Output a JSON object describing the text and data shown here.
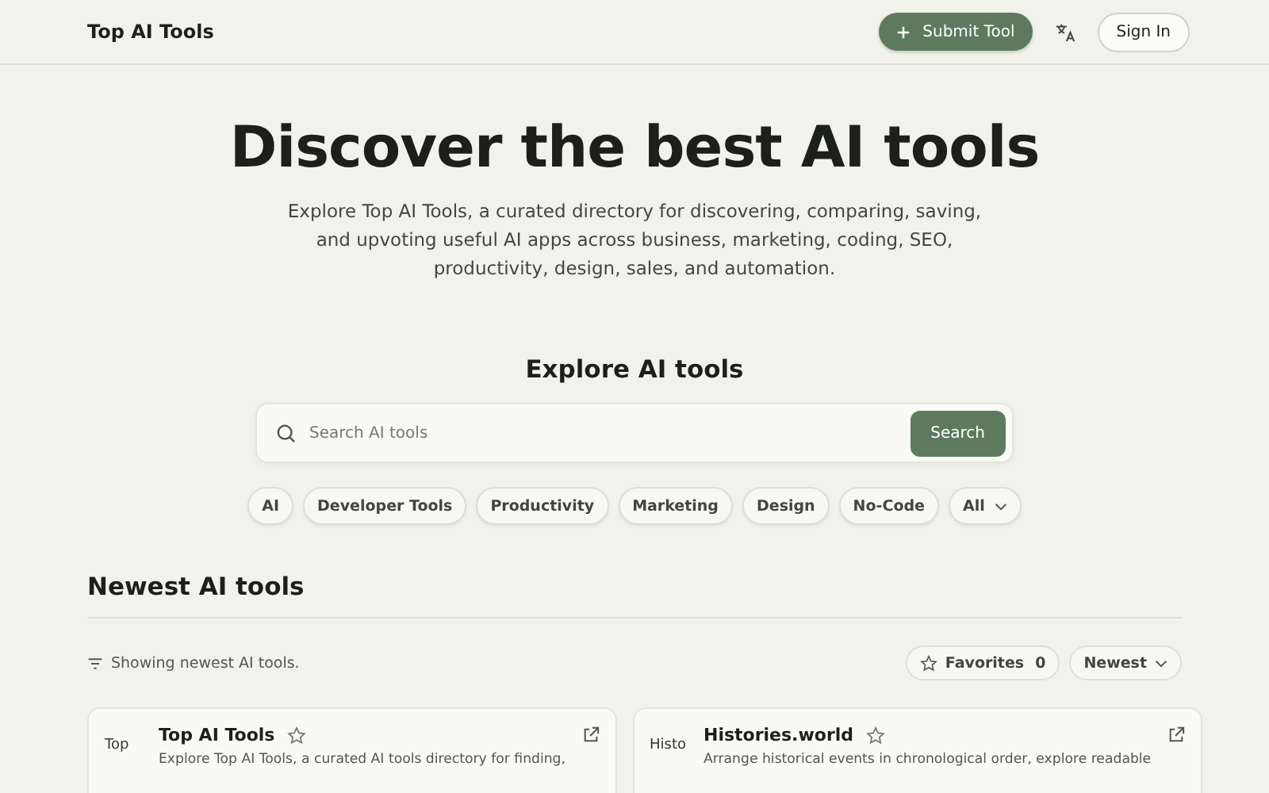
{
  "header": {
    "brand": "Top AI Tools",
    "submit_button": "Submit Tool",
    "sign_in": "Sign In"
  },
  "hero": {
    "title": "Discover the best AI tools",
    "description": "Explore Top AI Tools, a curated directory for discovering, comparing, saving, and upvoting useful AI apps across business, marketing, coding, SEO, productivity, design, sales, and automation."
  },
  "explore": {
    "heading": "Explore AI tools",
    "search": {
      "placeholder": "Search AI tools",
      "button": "Search"
    },
    "chips": [
      {
        "label": "AI",
        "kind": "chip"
      },
      {
        "label": "Developer Tools",
        "kind": "chip"
      },
      {
        "label": "Productivity",
        "kind": "chip"
      },
      {
        "label": "Marketing",
        "kind": "chip"
      },
      {
        "label": "Design",
        "kind": "chip"
      },
      {
        "label": "No-Code",
        "kind": "chip"
      },
      {
        "label": "All",
        "kind": "dropdown"
      }
    ]
  },
  "newest": {
    "heading": "Newest AI tools",
    "status": "Showing newest AI tools.",
    "favorites_label": "Favorites",
    "favorites_count": "0",
    "sort": "Newest",
    "cards": [
      {
        "image_alt": "Top",
        "name": "Top AI Tools",
        "favorited": false,
        "description": "Explore Top AI Tools, a curated AI tools directory for finding,"
      },
      {
        "image_alt": "Histo",
        "name": "Histories.world",
        "favorited": false,
        "description": "Arrange historical events in chronological order, explore readable"
      }
    ]
  }
}
